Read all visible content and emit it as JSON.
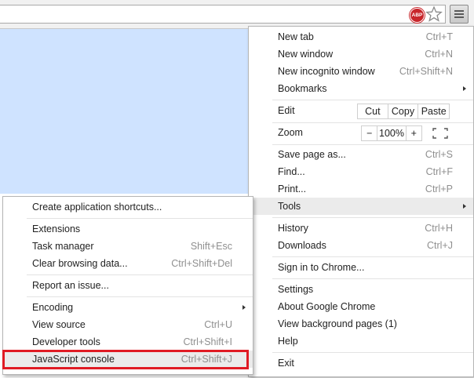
{
  "toolbar": {
    "abp_label": "ABP",
    "bookmark_icon": "star-icon",
    "menu_icon": "hamburger-menu-icon"
  },
  "main_menu": {
    "new_tab": {
      "label": "New tab",
      "shortcut": "Ctrl+T"
    },
    "new_window": {
      "label": "New window",
      "shortcut": "Ctrl+N"
    },
    "new_incognito": {
      "label": "New incognito window",
      "shortcut": "Ctrl+Shift+N"
    },
    "bookmarks": {
      "label": "Bookmarks"
    },
    "edit": {
      "label": "Edit",
      "cut": "Cut",
      "copy": "Copy",
      "paste": "Paste"
    },
    "zoom": {
      "label": "Zoom",
      "minus": "−",
      "value": "100%",
      "plus": "+"
    },
    "save_page": {
      "label": "Save page as...",
      "shortcut": "Ctrl+S"
    },
    "find": {
      "label": "Find...",
      "shortcut": "Ctrl+F"
    },
    "print": {
      "label": "Print...",
      "shortcut": "Ctrl+P"
    },
    "tools": {
      "label": "Tools"
    },
    "history": {
      "label": "History",
      "shortcut": "Ctrl+H"
    },
    "downloads": {
      "label": "Downloads",
      "shortcut": "Ctrl+J"
    },
    "sign_in": {
      "label": "Sign in to Chrome..."
    },
    "settings": {
      "label": "Settings"
    },
    "about": {
      "label": "About Google Chrome"
    },
    "background_pages": {
      "label": "View background pages (1)"
    },
    "help": {
      "label": "Help"
    },
    "exit": {
      "label": "Exit"
    }
  },
  "tools_menu": {
    "create_shortcuts": {
      "label": "Create application shortcuts..."
    },
    "extensions": {
      "label": "Extensions"
    },
    "task_manager": {
      "label": "Task manager",
      "shortcut": "Shift+Esc"
    },
    "clear_browsing": {
      "label": "Clear browsing data...",
      "shortcut": "Ctrl+Shift+Del"
    },
    "report_issue": {
      "label": "Report an issue..."
    },
    "encoding": {
      "label": "Encoding"
    },
    "view_source": {
      "label": "View source",
      "shortcut": "Ctrl+U"
    },
    "developer_tools": {
      "label": "Developer tools",
      "shortcut": "Ctrl+Shift+I"
    },
    "javascript_console": {
      "label": "JavaScript console",
      "shortcut": "Ctrl+Shift+J"
    }
  },
  "colors": {
    "highlight_border": "#e01b24",
    "page_background": "#cfe3ff",
    "menu_hover": "#ebebeb"
  }
}
